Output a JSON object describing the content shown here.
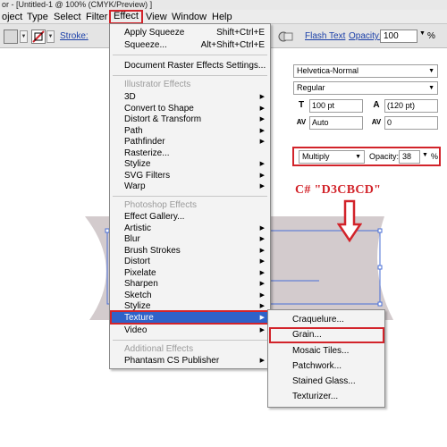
{
  "window": {
    "title": "or - [Untitled-1 @ 100% (CMYK/Preview) ]"
  },
  "menu_bar": {
    "items": [
      "oject",
      "Type",
      "Select",
      "Filter",
      "Effect",
      "View",
      "Window",
      "Help"
    ],
    "active": "Effect"
  },
  "control_bar": {
    "stroke_label": "Stroke:",
    "flash_text_label": "Flash Text",
    "opacity_label": "Opacity:",
    "opacity_value": "100",
    "opacity_unit": "%",
    "arrow_glyph": "▼",
    "icons": [
      "fill-swatch-icon",
      "stroke-none-icon",
      "brush-icon"
    ]
  },
  "character_panel": {
    "font_family": "Helvetica-Normal",
    "font_style": "Regular",
    "font_size": "100 pt",
    "leading": "(120 pt)",
    "kerning": "Auto",
    "tracking": "0",
    "icons": [
      "font-size-icon",
      "leading-icon",
      "kerning-icon",
      "tracking-icon"
    ]
  },
  "transparency": {
    "blend_mode": "Multiply",
    "opacity_label": "Opacity:",
    "opacity_value": "38",
    "opacity_unit": "%"
  },
  "annotation": {
    "text": "C# \"D3CBCD\"",
    "color": "#d2232a"
  },
  "artwork": {
    "fill_color": "#d3cbcd",
    "selection_color": "#4a6fd6"
  },
  "effect_menu": {
    "apply": {
      "label": "Apply Squeeze",
      "shortcut": "Shift+Ctrl+E"
    },
    "last": {
      "label": "Squeeze...",
      "shortcut": "Alt+Shift+Ctrl+E"
    },
    "document_raster": "Document Raster Effects Settings...",
    "illustrator_header": "Illustrator Effects",
    "illustrator_items": [
      "3D",
      "Convert to Shape",
      "Distort & Transform",
      "Path",
      "Pathfinder",
      "Rasterize...",
      "Stylize",
      "SVG Filters",
      "Warp"
    ],
    "photoshop_header": "Photoshop Effects",
    "photoshop_items": [
      "Effect Gallery...",
      "Artistic",
      "Blur",
      "Brush Strokes",
      "Distort",
      "Pixelate",
      "Sharpen",
      "Sketch",
      "Stylize",
      "Texture",
      "Video"
    ],
    "additional_header": "Additional Effects",
    "additional_items": [
      "Phantasm CS Publisher"
    ],
    "highlighted": "Texture",
    "submenu_arrow": "▶"
  },
  "texture_submenu": {
    "items": [
      "Craquelure...",
      "Grain...",
      "Mosaic Tiles...",
      "Patchwork...",
      "Stained Glass...",
      "Texturizer..."
    ],
    "emphasized": "Grain..."
  }
}
